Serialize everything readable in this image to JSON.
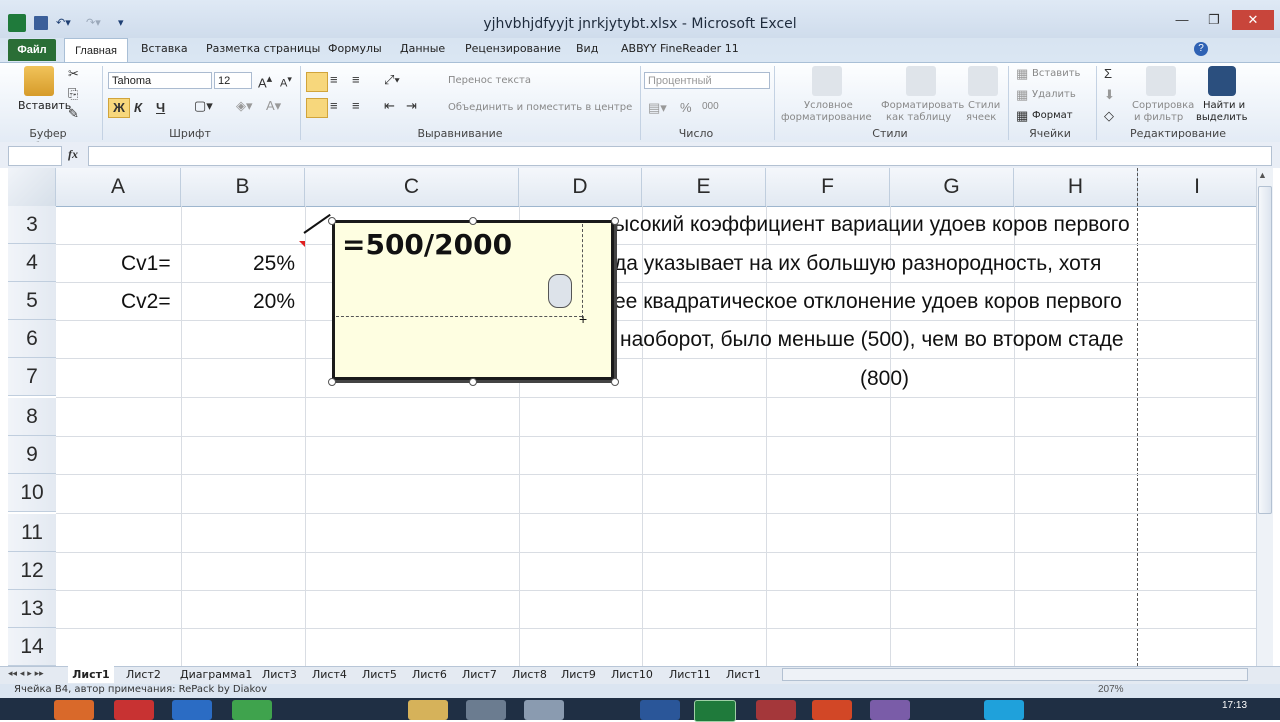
{
  "window": {
    "title": "yjhvbhjdfyyjt jnrkjytybt.xlsx  -  Microsoft Excel",
    "min_label": "—",
    "max_label": "❐",
    "close_label": "✕"
  },
  "ribbon_tabs": {
    "file": "Файл",
    "home": "Главная",
    "insert": "Вставка",
    "page_layout": "Разметка страницы",
    "formulas": "Формулы",
    "data": "Данные",
    "review": "Рецензирование",
    "view": "Вид",
    "abbyy": "ABBYY FineReader 11"
  },
  "clipboard": {
    "paste": "Вставить",
    "group": "Буфер обмена"
  },
  "font": {
    "name": "Tahoma",
    "size": "12",
    "bold": "Ж",
    "italic": "К",
    "underline": "Ч",
    "group": "Шрифт"
  },
  "alignment": {
    "wrap": "Перенос текста",
    "merge": "Объединить и поместить в центре",
    "group": "Выравнивание"
  },
  "number": {
    "format": "Процентный",
    "percent": "%",
    "thousands": "000",
    "group": "Число"
  },
  "styles": {
    "conditional_1": "Условное",
    "conditional_2": "форматирование",
    "table_1": "Форматировать",
    "table_2": "как таблицу",
    "cell_1": "Стили",
    "cell_2": "ячеек",
    "group": "Стили"
  },
  "cells": {
    "insert": "Вставить",
    "delete": "Удалить",
    "format": "Формат",
    "group": "Ячейки"
  },
  "editing": {
    "sum": "Σ",
    "sort_1": "Сортировка",
    "sort_2": "и фильтр",
    "find_1": "Найти и",
    "find_2": "выделить",
    "group": "Редактирование"
  },
  "formula_bar": {
    "fx": "fx",
    "value": ""
  },
  "columns": [
    "A",
    "B",
    "C",
    "D",
    "E",
    "F",
    "G",
    "H",
    "I"
  ],
  "rows": [
    "3",
    "4",
    "5",
    "6",
    "7",
    "8",
    "9",
    "10",
    "11",
    "12",
    "13",
    "14"
  ],
  "cells_data": {
    "a4": "Cv1=",
    "b4": "25%",
    "a5": "Cv2=",
    "b5": "20%"
  },
  "overflow_text": {
    "line1": "ысокий коэффициент вариации удоев коров первого",
    "line2": "да указывает на их большую разнородность, хотя",
    "line3": "ее квадратическое отклонение удоев коров первого",
    "line4": "наоборот, было меньше (500), чем во втором стаде",
    "line5": "(800)"
  },
  "comment": {
    "text": "=500/2000"
  },
  "sheet_tabs": [
    "Лист1",
    "Лист2",
    "Диаграмма1",
    "Лист3",
    "Лист4",
    "Лист5",
    "Лист6",
    "Лист7",
    "Лист8",
    "Лист9",
    "Лист10",
    "Лист11",
    "Лист1"
  ],
  "status": {
    "text": "Ячейка B4, автор примечания: RePack by Diakov",
    "zoom": "207%",
    "clock": "17:13"
  },
  "colors": {
    "file_tab": "#2a6e36",
    "comment_bg": "#fefee1",
    "ribbon_bg": "#e3ebf5",
    "taskbar": "#1f2f44"
  }
}
